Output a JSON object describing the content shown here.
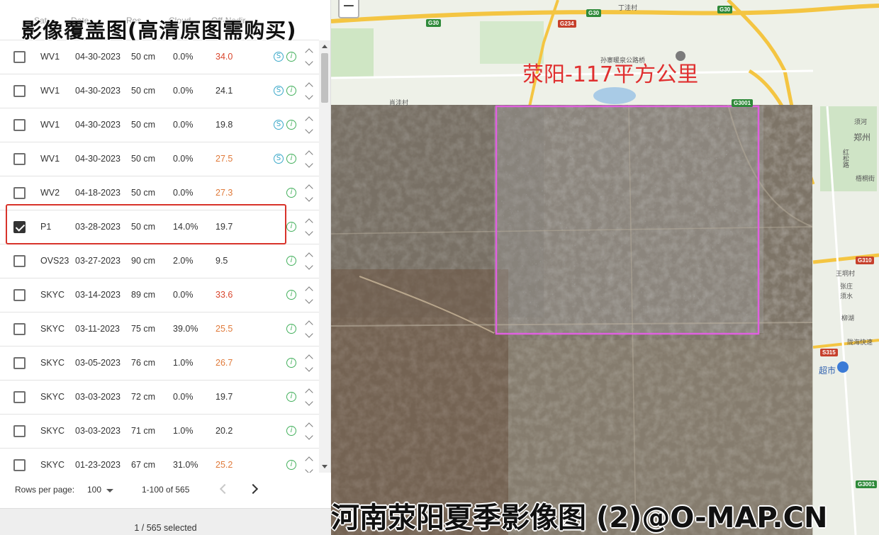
{
  "overlay_title": "影像覆盖图(高清原图需购买)",
  "table": {
    "header_columns": [
      "Sat",
      "Date",
      "Res",
      "Cloud",
      "Off-Nadir"
    ],
    "rows": [
      {
        "sat": "WV1",
        "date": "04-30-2023",
        "res": "50 cm",
        "cloud": "0.0%",
        "off": "34.0",
        "off_level": "red",
        "s_icon": true,
        "checked": false
      },
      {
        "sat": "WV1",
        "date": "04-30-2023",
        "res": "50 cm",
        "cloud": "0.0%",
        "off": "24.1",
        "off_level": "normal",
        "s_icon": true,
        "checked": false
      },
      {
        "sat": "WV1",
        "date": "04-30-2023",
        "res": "50 cm",
        "cloud": "0.0%",
        "off": "19.8",
        "off_level": "normal",
        "s_icon": true,
        "checked": false
      },
      {
        "sat": "WV1",
        "date": "04-30-2023",
        "res": "50 cm",
        "cloud": "0.0%",
        "off": "27.5",
        "off_level": "orange",
        "s_icon": true,
        "checked": false
      },
      {
        "sat": "WV2",
        "date": "04-18-2023",
        "res": "50 cm",
        "cloud": "0.0%",
        "off": "27.3",
        "off_level": "orange",
        "s_icon": false,
        "checked": false
      },
      {
        "sat": "P1",
        "date": "03-28-2023",
        "res": "50 cm",
        "cloud": "14.0%",
        "off": "19.7",
        "off_level": "normal",
        "s_icon": false,
        "checked": true
      },
      {
        "sat": "OVS23",
        "date": "03-27-2023",
        "res": "90 cm",
        "cloud": "2.0%",
        "off": "9.5",
        "off_level": "normal",
        "s_icon": false,
        "checked": false
      },
      {
        "sat": "SKYC",
        "date": "03-14-2023",
        "res": "89 cm",
        "cloud": "0.0%",
        "off": "33.6",
        "off_level": "red",
        "s_icon": false,
        "checked": false
      },
      {
        "sat": "SKYC",
        "date": "03-11-2023",
        "res": "75 cm",
        "cloud": "39.0%",
        "off": "25.5",
        "off_level": "orange",
        "s_icon": false,
        "checked": false
      },
      {
        "sat": "SKYC",
        "date": "03-05-2023",
        "res": "76 cm",
        "cloud": "1.0%",
        "off": "26.7",
        "off_level": "orange",
        "s_icon": false,
        "checked": false
      },
      {
        "sat": "SKYC",
        "date": "03-03-2023",
        "res": "72 cm",
        "cloud": "0.0%",
        "off": "19.7",
        "off_level": "normal",
        "s_icon": false,
        "checked": false
      },
      {
        "sat": "SKYC",
        "date": "03-03-2023",
        "res": "71 cm",
        "cloud": "1.0%",
        "off": "20.2",
        "off_level": "normal",
        "s_icon": false,
        "checked": false
      },
      {
        "sat": "SKYC",
        "date": "01-23-2023",
        "res": "67 cm",
        "cloud": "31.0%",
        "off": "25.2",
        "off_level": "orange",
        "s_icon": false,
        "checked": false
      }
    ],
    "s_icon_glyph": "S",
    "i_icon_glyph": "i"
  },
  "pagination": {
    "rows_per_page_label": "Rows per page:",
    "rows_per_page_value": "100",
    "range_text": "1-100 of 565"
  },
  "footer": {
    "selected_text": "1 / 565 selected"
  },
  "map": {
    "zoom_out_label": "−",
    "area_label": "荥阳-117平方公里",
    "watermark": "河南荥阳夏季影像图 (2)@O-MAP.CN",
    "road_tags": [
      "G30",
      "G30",
      "G30",
      "G234",
      "G3001",
      "G310",
      "S315",
      "G3001"
    ],
    "places": [
      "丁洼村",
      "孙寨暖泉公路桥",
      "肖洼村",
      "须河",
      "郑州",
      "红松路",
      "梧桐街",
      "王垌村",
      "张庄",
      "须水",
      "柳湖",
      "陇海快速",
      "超市"
    ],
    "colors": {
      "aoi_outline": "#e060e0",
      "label_red": "#e02f2f",
      "highway_yellow": "#f4c542",
      "road_tag_green": "#2f8a3a"
    }
  }
}
